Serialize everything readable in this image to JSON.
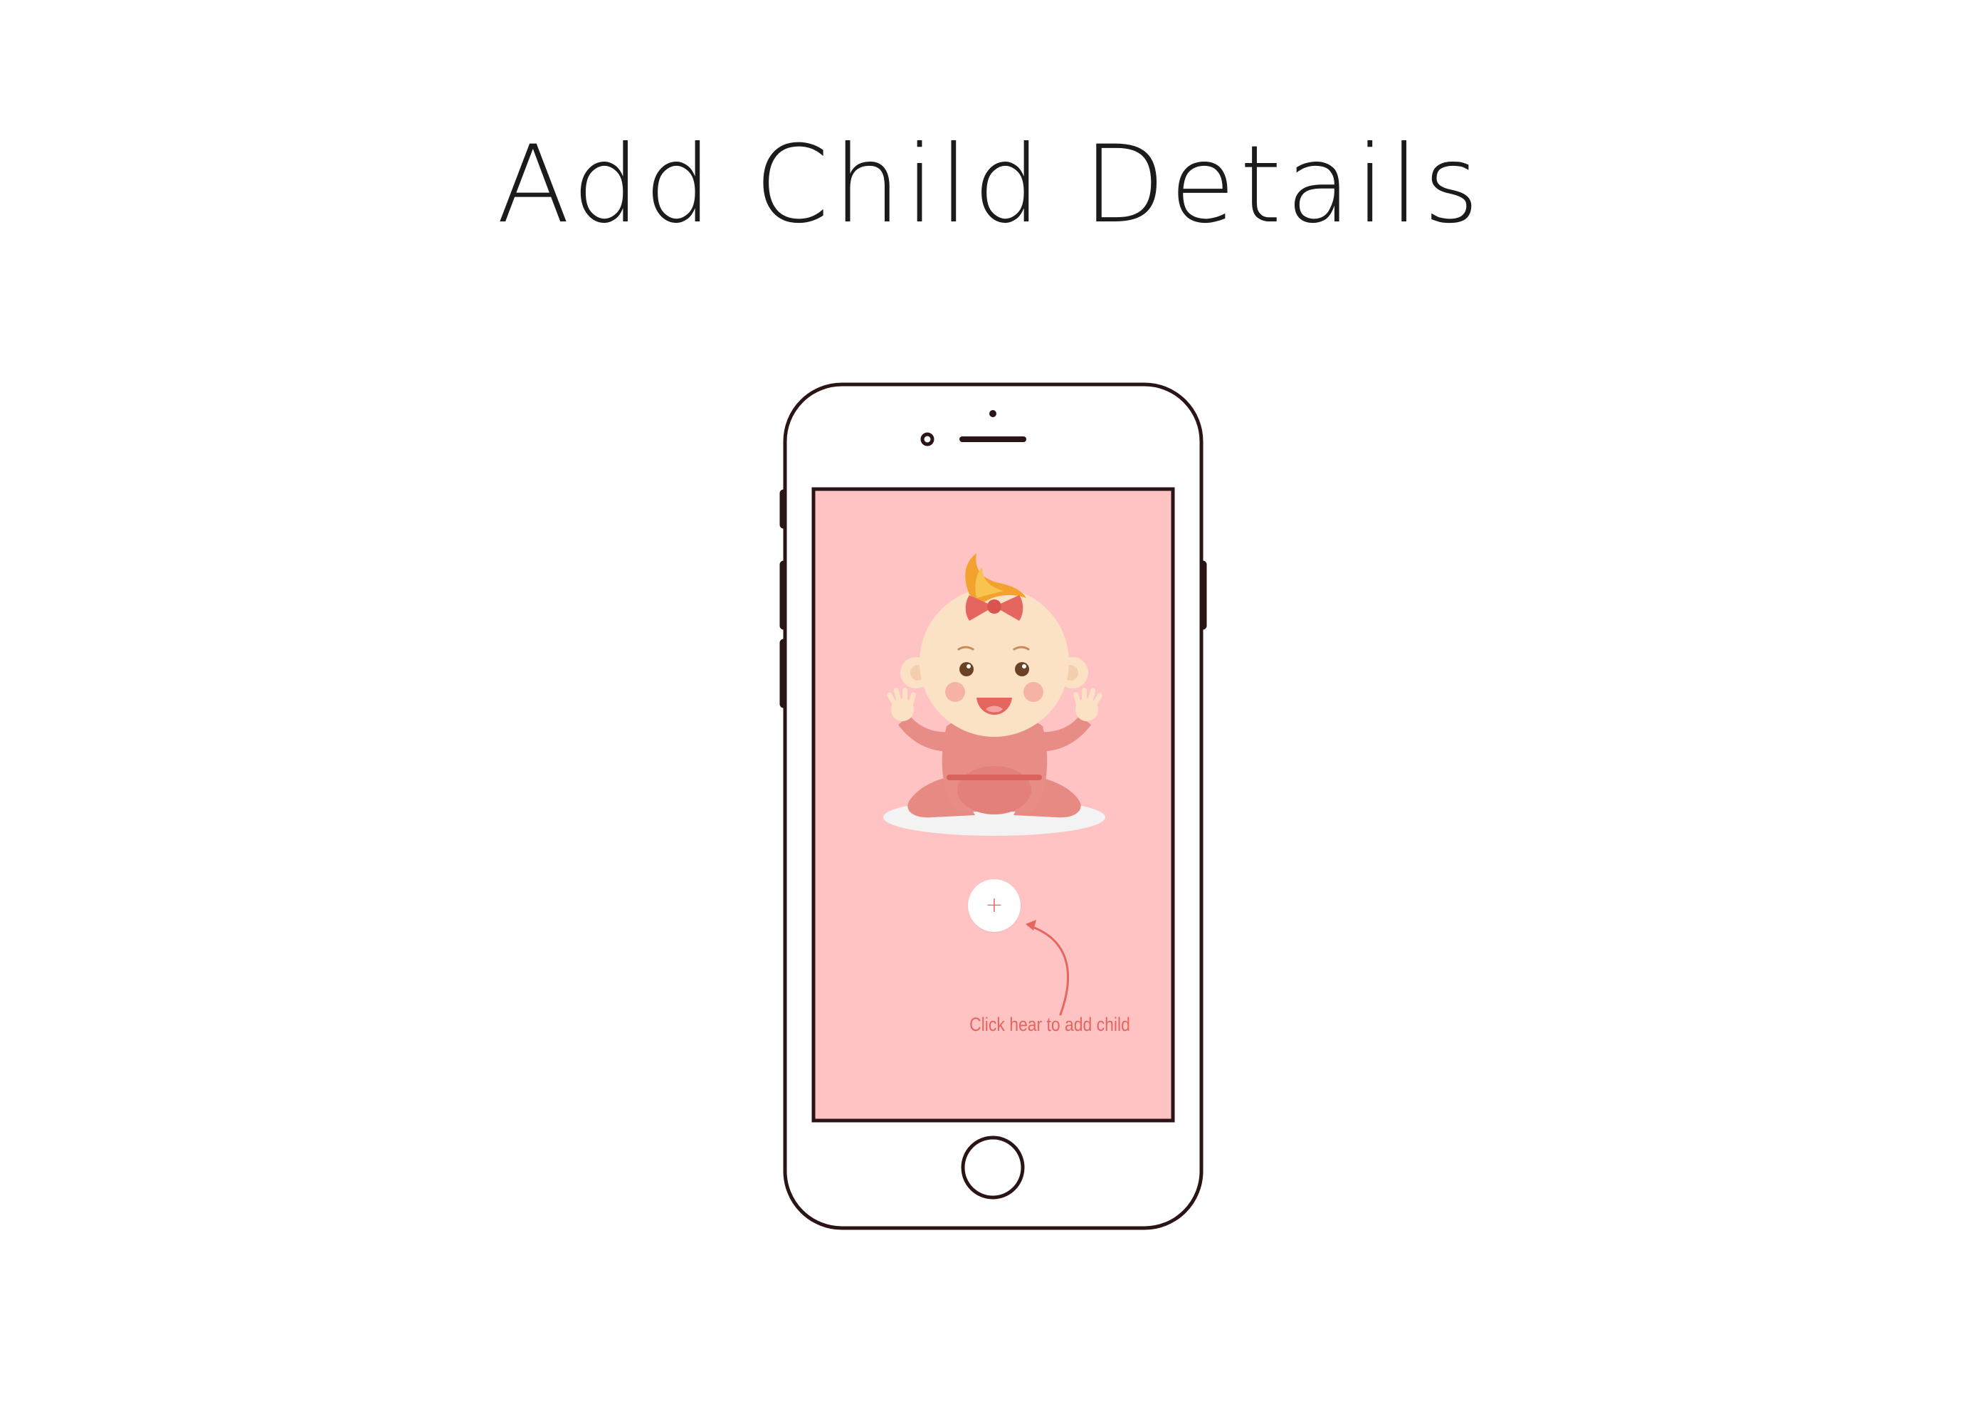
{
  "header": {
    "title": "Add Child Details"
  },
  "screen": {
    "add_button_symbol": "+",
    "hint_text": "Click hear to add child",
    "illustration": "baby-girl-illustration"
  },
  "colors": {
    "screen_background": "#ffc3c4",
    "accent": "#e4665f",
    "phone_outline": "#2a1416",
    "title_text": "#1b1b1b"
  }
}
